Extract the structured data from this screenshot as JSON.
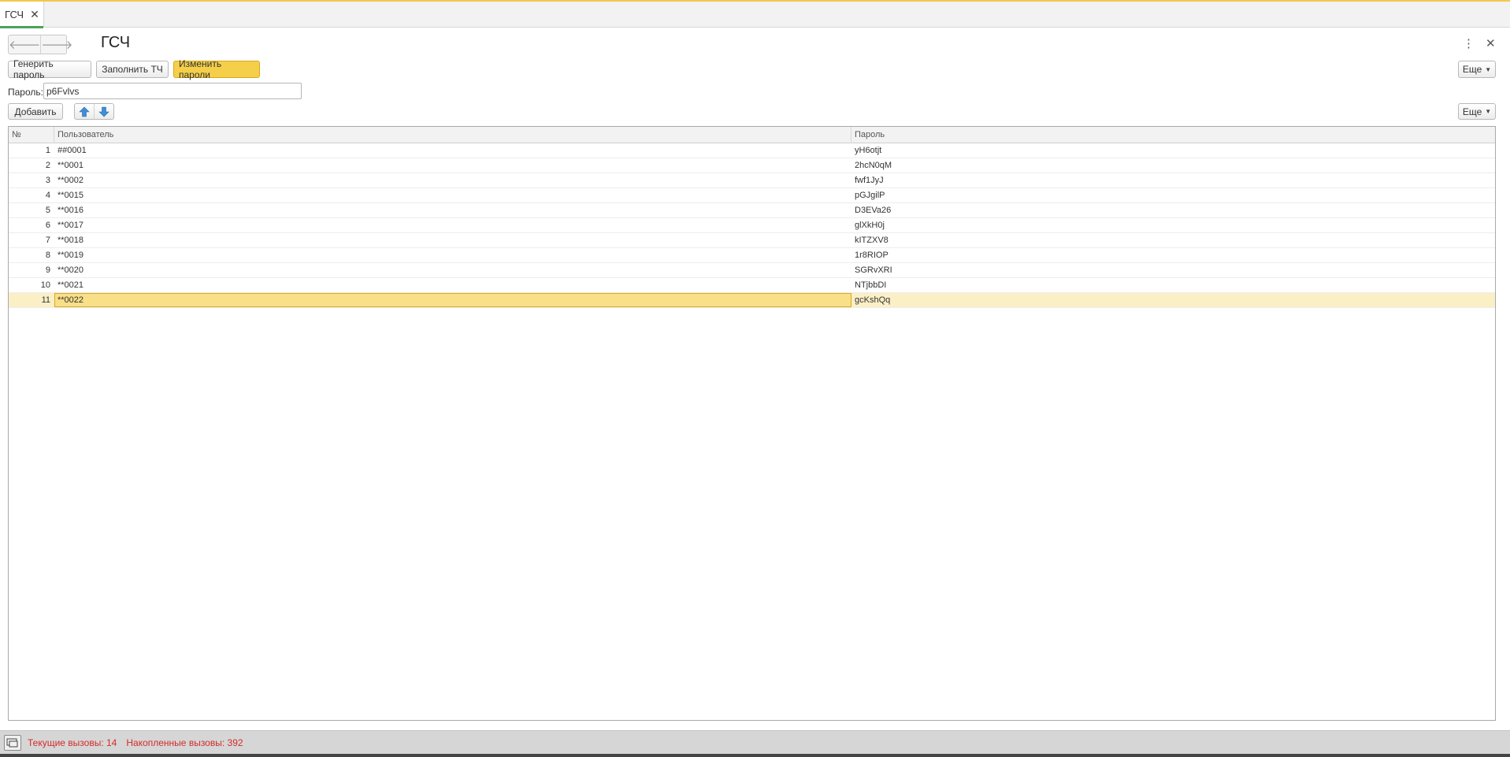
{
  "tab": {
    "label": "ГСЧ"
  },
  "header": {
    "title": "ГСЧ"
  },
  "toolbar": {
    "generate_label": "Генерить пароль",
    "fill_label": "Заполнить ТЧ",
    "change_label": "Изменить пароли",
    "more_label": "Еще"
  },
  "password": {
    "label": "Пароль:",
    "value": "p6Fvlvs"
  },
  "table_toolbar": {
    "add_label": "Добавить",
    "more_label": "Еще"
  },
  "table": {
    "columns": [
      "№",
      "Пользователь",
      "Пароль"
    ],
    "rows": [
      {
        "no": "1",
        "user": "##0001",
        "password": "yH6otjt"
      },
      {
        "no": "2",
        "user": "**0001",
        "password": "2hcN0qM"
      },
      {
        "no": "3",
        "user": "**0002",
        "password": "fwf1JyJ"
      },
      {
        "no": "4",
        "user": "**0015",
        "password": "pGJgilP"
      },
      {
        "no": "5",
        "user": "**0016",
        "password": "D3EVa26"
      },
      {
        "no": "6",
        "user": "**0017",
        "password": "glXkH0j"
      },
      {
        "no": "7",
        "user": "**0018",
        "password": "kITZXV8"
      },
      {
        "no": "8",
        "user": "**0019",
        "password": "1r8RIOP"
      },
      {
        "no": "9",
        "user": "**0020",
        "password": "SGRvXRI"
      },
      {
        "no": "10",
        "user": "**0021",
        "password": "NTjbbDI"
      },
      {
        "no": "11",
        "user": "**0022",
        "password": "gcKshQq"
      }
    ],
    "selected_row": 11
  },
  "status": {
    "current_calls": "Текущие вызовы: 14",
    "accumulated_calls": "Накопленные вызовы: 392"
  },
  "colors": {
    "accent": "#f5cf4a",
    "tab_underline": "#4ba35a",
    "status_text": "#d42a2a",
    "arrow_blue": "#3f8fd6"
  }
}
